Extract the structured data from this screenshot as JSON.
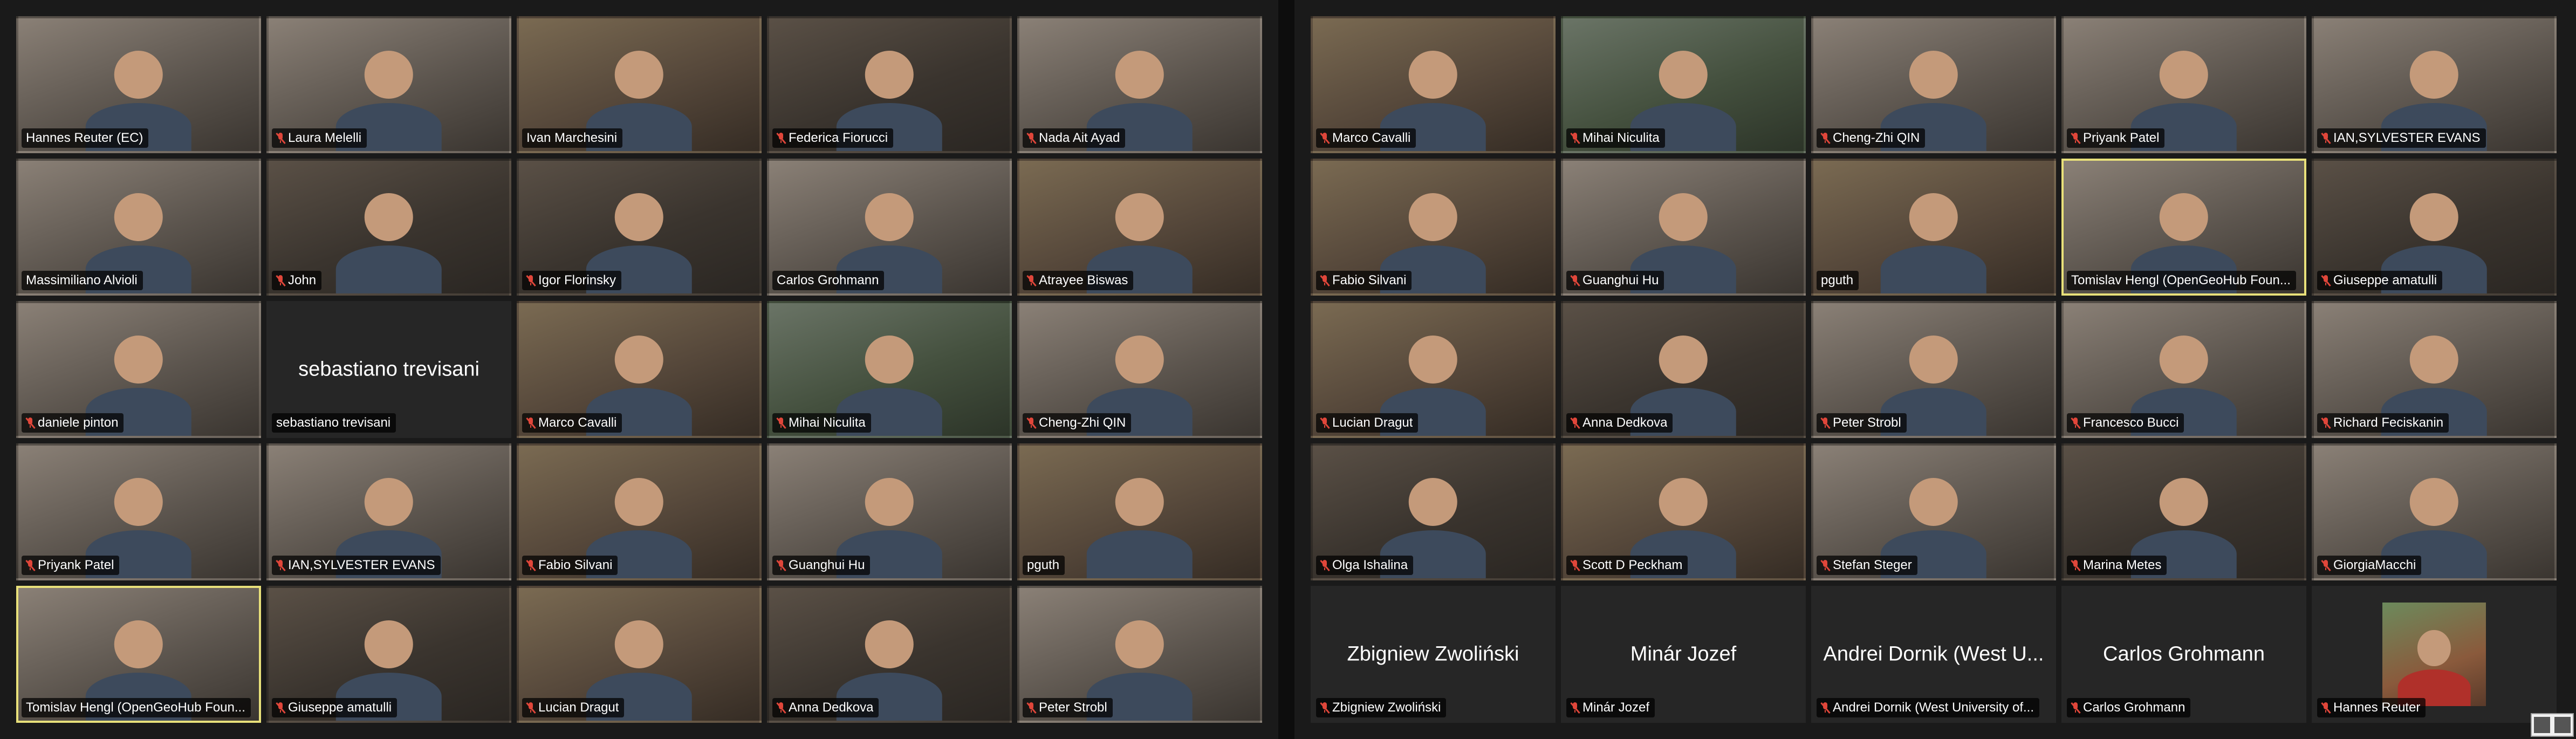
{
  "panels": [
    {
      "id": "left",
      "tiles": [
        {
          "name": "Hannes Reuter (EC)",
          "muted": false,
          "video": true,
          "tone": "v3"
        },
        {
          "name": "Laura Melelli",
          "muted": true,
          "video": true,
          "tone": "v3"
        },
        {
          "name": "Ivan Marchesini",
          "muted": false,
          "video": true,
          "tone": "v4"
        },
        {
          "name": "Federica Fiorucci",
          "muted": true,
          "video": true,
          "tone": "v1"
        },
        {
          "name": "Nada Ait Ayad",
          "muted": true,
          "video": true,
          "tone": "v3"
        },
        {
          "name": "Massimiliano Alvioli",
          "muted": false,
          "video": true,
          "tone": "v3"
        },
        {
          "name": "John",
          "muted": true,
          "video": true,
          "tone": "v1"
        },
        {
          "name": "Igor Florinsky",
          "muted": true,
          "video": true,
          "tone": "v1"
        },
        {
          "name": "Carlos Grohmann",
          "muted": false,
          "video": true,
          "tone": "v3"
        },
        {
          "name": "Atrayee Biswas",
          "muted": true,
          "video": true,
          "tone": "v4"
        },
        {
          "name": "daniele pinton",
          "muted": true,
          "video": true,
          "tone": "v3"
        },
        {
          "name": "sebastiano trevisani",
          "muted": false,
          "video": false,
          "display": "sebastiano trevisani"
        },
        {
          "name": "Marco Cavalli",
          "muted": true,
          "video": true,
          "tone": "v4"
        },
        {
          "name": "Mihai Niculita",
          "muted": true,
          "video": true,
          "tone": "v2"
        },
        {
          "name": "Cheng-Zhi QIN",
          "muted": true,
          "video": true,
          "tone": "v3"
        },
        {
          "name": "Priyank Patel",
          "muted": true,
          "video": true,
          "tone": "v3"
        },
        {
          "name": "IAN,SYLVESTER EVANS",
          "muted": true,
          "video": true,
          "tone": "v3"
        },
        {
          "name": "Fabio Silvani",
          "muted": true,
          "video": true,
          "tone": "v4"
        },
        {
          "name": "Guanghui Hu",
          "muted": true,
          "video": true,
          "tone": "v3"
        },
        {
          "name": "pguth",
          "muted": false,
          "video": true,
          "tone": "v4"
        },
        {
          "name": "Tomislav Hengl (OpenGeoHub Foun...",
          "muted": false,
          "video": true,
          "tone": "v3",
          "active": true
        },
        {
          "name": "Giuseppe amatulli",
          "muted": true,
          "video": true,
          "tone": "v1"
        },
        {
          "name": "Lucian Dragut",
          "muted": true,
          "video": true,
          "tone": "v4"
        },
        {
          "name": "Anna Dedkova",
          "muted": true,
          "video": true,
          "tone": "v1"
        },
        {
          "name": "Peter Strobl",
          "muted": true,
          "video": true,
          "tone": "v3"
        }
      ]
    },
    {
      "id": "right",
      "tiles": [
        {
          "name": "Marco Cavalli",
          "muted": true,
          "video": true,
          "tone": "v4"
        },
        {
          "name": "Mihai Niculita",
          "muted": true,
          "video": true,
          "tone": "v2"
        },
        {
          "name": "Cheng-Zhi QIN",
          "muted": true,
          "video": true,
          "tone": "v3"
        },
        {
          "name": "Priyank Patel",
          "muted": true,
          "video": true,
          "tone": "v3"
        },
        {
          "name": "IAN,SYLVESTER EVANS",
          "muted": true,
          "video": true,
          "tone": "v3"
        },
        {
          "name": "Fabio Silvani",
          "muted": true,
          "video": true,
          "tone": "v4"
        },
        {
          "name": "Guanghui Hu",
          "muted": true,
          "video": true,
          "tone": "v3"
        },
        {
          "name": "pguth",
          "muted": false,
          "video": true,
          "tone": "v4"
        },
        {
          "name": "Tomislav Hengl (OpenGeoHub Foun...",
          "muted": false,
          "video": true,
          "tone": "v3",
          "active": true
        },
        {
          "name": "Giuseppe amatulli",
          "muted": true,
          "video": true,
          "tone": "v1"
        },
        {
          "name": "Lucian Dragut",
          "muted": true,
          "video": true,
          "tone": "v4"
        },
        {
          "name": "Anna Dedkova",
          "muted": true,
          "video": true,
          "tone": "v1"
        },
        {
          "name": "Peter Strobl",
          "muted": true,
          "video": true,
          "tone": "v3"
        },
        {
          "name": "Francesco Bucci",
          "muted": true,
          "video": true,
          "tone": "v3"
        },
        {
          "name": "Richard Feciskanin",
          "muted": true,
          "video": true,
          "tone": "v3"
        },
        {
          "name": "Olga Ishalina",
          "muted": true,
          "video": true,
          "tone": "v1"
        },
        {
          "name": "Scott D Peckham",
          "muted": true,
          "video": true,
          "tone": "v4"
        },
        {
          "name": "Stefan Steger",
          "muted": true,
          "video": true,
          "tone": "v3"
        },
        {
          "name": "Marina Metes",
          "muted": true,
          "video": true,
          "tone": "v1"
        },
        {
          "name": "GiorgiaMacchi",
          "muted": true,
          "video": true,
          "tone": "v3"
        },
        {
          "name": "Zbigniew Zwoliński",
          "muted": true,
          "video": false,
          "display": "Zbigniew Zwoliński"
        },
        {
          "name": "Minár Jozef",
          "muted": true,
          "video": false,
          "display": "Minár Jozef"
        },
        {
          "name": "Andrei Dornik (West University of...",
          "muted": true,
          "video": false,
          "display": "Andrei Dornik (West U..."
        },
        {
          "name": "Carlos Grohmann",
          "muted": true,
          "video": false,
          "display": "Carlos Grohmann"
        },
        {
          "name": "Hannes Reuter",
          "muted": true,
          "video": false,
          "small_video": true
        }
      ]
    }
  ],
  "colors": {
    "background": "#1a1a1a",
    "active_speaker_border": "#e8e07a",
    "mute_icon": "#e0463a",
    "name_text": "#ffffff"
  }
}
